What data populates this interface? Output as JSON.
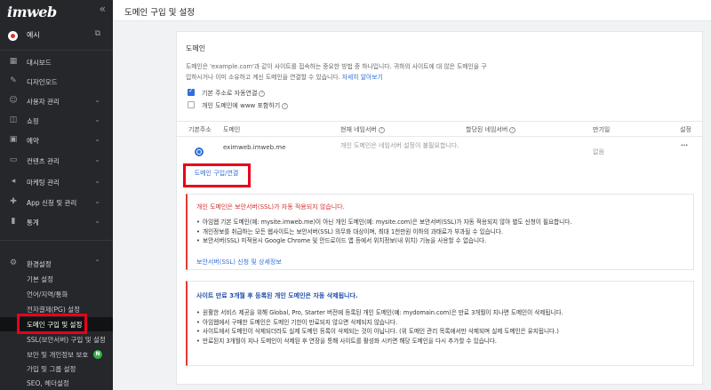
{
  "sidebar": {
    "logo": "imweb",
    "collapse_icon": "double-chevron-left",
    "site_name": "예시",
    "items": [
      {
        "label": "대시보드",
        "icon": "grid-icon"
      },
      {
        "label": "디자인모드",
        "icon": "wand-icon"
      },
      {
        "label": "사용자 관리",
        "icon": "user-icon"
      },
      {
        "label": "쇼핑",
        "icon": "bag-icon"
      },
      {
        "label": "예약",
        "icon": "calendar-icon"
      },
      {
        "label": "컨텐츠 관리",
        "icon": "folder-icon"
      },
      {
        "label": "마케팅 관리",
        "icon": "megaphone-icon"
      },
      {
        "label": "App 신청 및 관리",
        "icon": "puzzle-icon"
      },
      {
        "label": "통계",
        "icon": "chart-icon"
      }
    ],
    "settings": {
      "label": "환경설정",
      "icon": "gear-icon",
      "sub": [
        "기본 설정",
        "언어/지역/통화",
        "전자결제(PG) 설정",
        "도메인 구입 및 설정",
        "SSL(보안서버) 구입 및 설정",
        "보안 및 개인정보 보호",
        "가입 및 그룹 설정",
        "SEO, 헤더설정"
      ],
      "badge": "N"
    }
  },
  "header": {
    "title": "도메인 구입 및 설정"
  },
  "domain": {
    "title": "도메인",
    "desc": "도메인은 'example.com'과 같이 사이트를 접속하는 중요한 방법 중 하나입니다. 귀하의 사이트에 대 않은 도메인을 구입하시거나 이미 소유하고 계신 도메인을 연결할 수 있습니다.",
    "desc_link": "자세히 알아보기",
    "checkbox1": "기본 주소로 자동연결",
    "checkbox2": "개인 도메인에 www 포함하기",
    "columns": [
      "기본주소",
      "도메인",
      "현재 네임서버",
      "할당된 네임서버",
      "만기일",
      "설정"
    ],
    "row": {
      "domain": "eximweb.imweb.me",
      "current_ns": "개인 도메인은 네임서버 설정이 불필요합니다.",
      "expiry": "없음",
      "more": "···"
    },
    "buy_button": "도메인 구입/연결"
  },
  "notice_ssl": {
    "title": "개인 도메인은 보안서버(SSL)가 자동 적용되지 않습니다.",
    "items": [
      "아임웹 기본 도메인(예: mysite.imweb.me)이 아닌 개인 도메인(예: mysite.com)은 보안서버(SSL)가 자동 적용되지 않아 별도 신청이 필요합니다.",
      "개인정보를 취급하는 모든 웹사이트는 보안서버(SSL) 의무화 대상이며, 최대 1천만원 이하의 과태료가 부과될 수 있습니다.",
      "보안서버(SSL) 미적용시 Google Chrome 및 안드로이드 앱 등에서 위치정보(내 위치) 기능을 사용할 수 없습니다."
    ],
    "link": "보안서버(SSL) 신청 및 상세정보"
  },
  "notice_expire": {
    "title": "사이트 만료 3개월 후 등록된 개인 도메인은 자동 삭제됩니다.",
    "items": [
      "원활한 서비스 제공을 위해 Global, Pro, Starter 버전에 등록된 개인 도메인(예: mydomain.com)은 만료 3개월이 지나면 도메인이 삭제됩니다.",
      "아임웹에서 구매한 도메인은 도메인 기한이 만료되지 않으면 삭제되지 않습니다.",
      "사이트에서 도메인이 삭제되더라도 실제 도메인 등록이 삭제되는 것이 아닙니다. (위 도메인 관리 목록에서만 삭제되며 실제 도메인은 유지됩니다.)",
      "만료된지 3개월이 지나 도메인이 삭제된 후 연장을 통해 사이트를 활성화 시키면 해당 도메인을 다시 추가할 수 있습니다."
    ]
  },
  "colors": {
    "accent": "#2f6fd8",
    "highlight": "#e8001c",
    "sidebar": "#25272b",
    "notice_red": "#d32f2f"
  }
}
